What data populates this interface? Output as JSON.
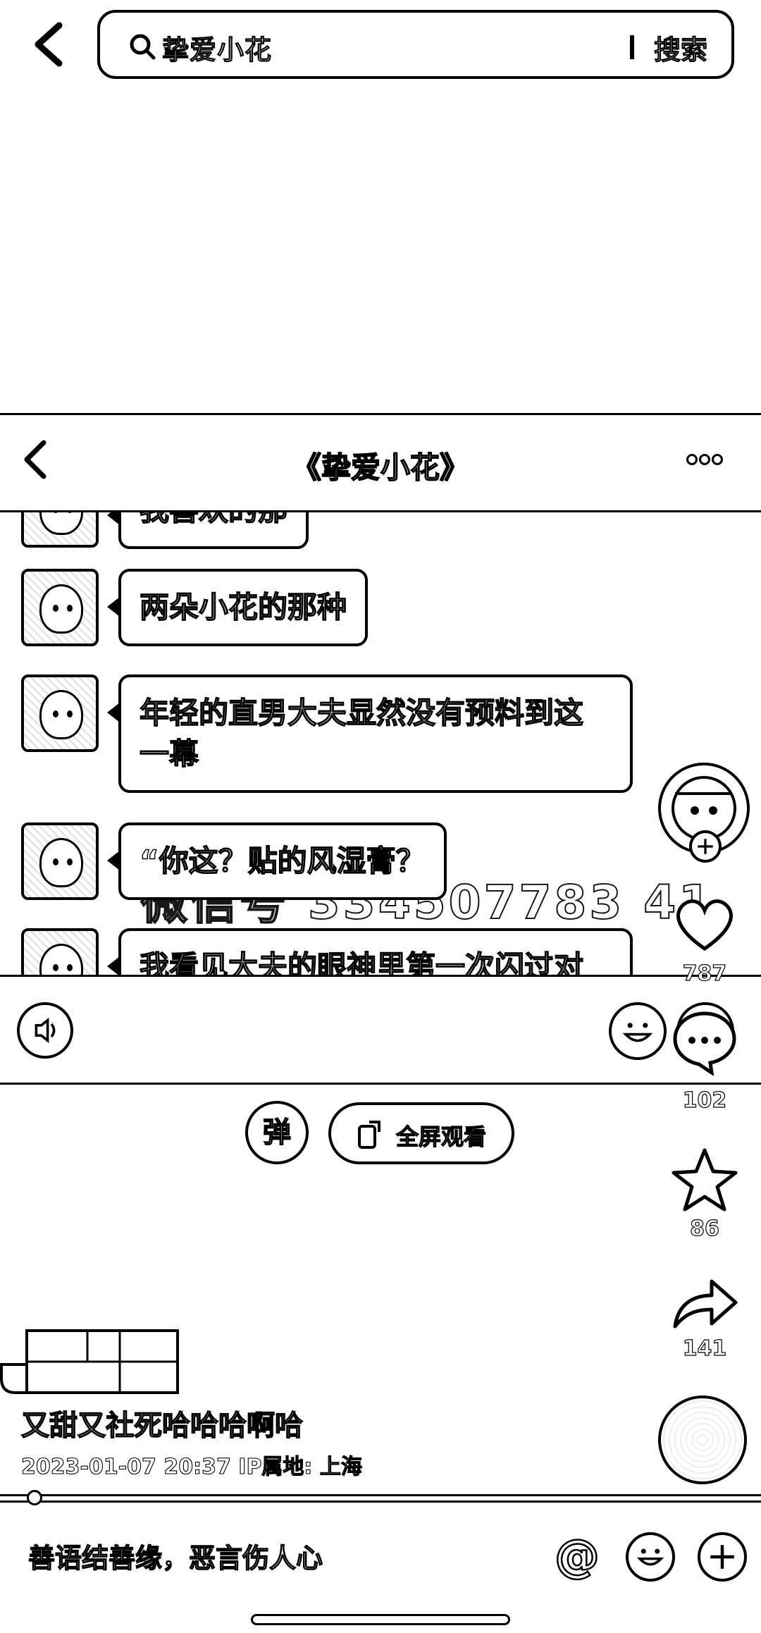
{
  "search": {
    "query": "挚爱小花",
    "button_label": "搜索"
  },
  "chat": {
    "title": "《挚爱小花》",
    "messages": [
      {
        "text": "我喜欢的那"
      },
      {
        "text": "两朵小花的那种"
      },
      {
        "text": "年轻的直男大夫显然没有预料到这一幕"
      },
      {
        "text": "“你这？贴的风湿膏？"
      },
      {
        "text": "我看见大夫的眼神里第一次闪过对"
      }
    ],
    "watermark": "微信号 334507783 41"
  },
  "controls": {
    "danmu_label": "弹",
    "fullscreen_label": "全屏观看"
  },
  "side": {
    "like_count": "787",
    "comment_count": "102",
    "favorite_count": "86",
    "share_count": "141"
  },
  "post": {
    "caption": "又甜又社死哈哈哈啊哈",
    "meta": "2023-01-07 20:37  IP属地: 上海"
  },
  "bottom": {
    "comment_placeholder": "善语结善缘，恶言伤人心",
    "at_icon": "@"
  }
}
